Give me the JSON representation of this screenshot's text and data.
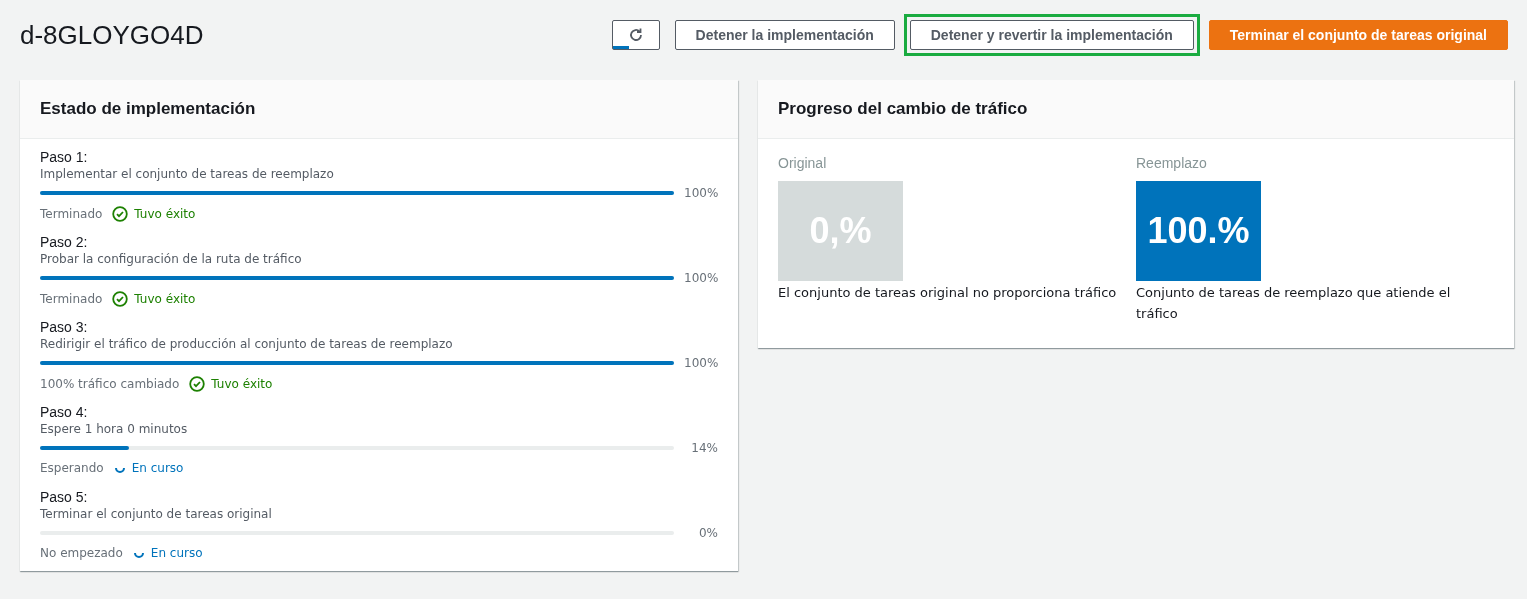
{
  "title": "d-8GLOYGO4D",
  "buttons": [
    {
      "kind": "refresh",
      "highlighted": false
    },
    {
      "kind": "normal",
      "label": "Detener la implementación",
      "highlighted": false
    },
    {
      "kind": "normal",
      "label": "Detener y revertir la implementación",
      "highlighted": true
    },
    {
      "kind": "primary",
      "label": "Terminar el conjunto de tareas original",
      "highlighted": false
    }
  ],
  "deployment_status": {
    "title": "Estado de implementación",
    "steps": [
      {
        "name": "Paso 1:",
        "description": "Implementar el conjunto de tareas de reemplazo",
        "level": 1,
        "percent": "100%",
        "state": "Terminado",
        "status": {
          "kind": "success",
          "label": "Tuvo éxito"
        }
      },
      {
        "name": "Paso 2:",
        "description": "Probar la configuración de la ruta de tráfico",
        "level": 1,
        "percent": "100%",
        "state": "Terminado",
        "status": {
          "kind": "success",
          "label": "Tuvo éxito"
        }
      },
      {
        "name": "Paso 3:",
        "description": "Redirigir el tráfico de producción al conjunto de tareas de reemplazo",
        "level": 1,
        "percent": "100%",
        "state": "100% tráfico cambiado",
        "status": {
          "kind": "success",
          "label": "Tuvo éxito"
        }
      },
      {
        "name": "Paso 4:",
        "description": "Espere 1 hora 0 minutos",
        "level": 0.14,
        "percent": "14%",
        "state": "Esperando",
        "status": {
          "kind": "in_progress",
          "label": "En curso"
        }
      },
      {
        "name": "Paso 5:",
        "description": "Terminar el conjunto de tareas original",
        "level": 0,
        "percent": "0%",
        "state": "No empezado",
        "status": {
          "kind": "in_progress",
          "label": "En curso"
        }
      }
    ]
  },
  "traffic_shift": {
    "title": "Progreso del cambio de tráfico",
    "sets": [
      {
        "label": "Original",
        "value": "0,%",
        "kind": "inactive",
        "caption": "El conjunto de tareas original no proporciona tráfico"
      },
      {
        "label": "Reemplazo",
        "value": "100.%",
        "kind": "active",
        "caption": "Conjunto de tareas de reemplazo que atiende el tráfico"
      }
    ]
  }
}
